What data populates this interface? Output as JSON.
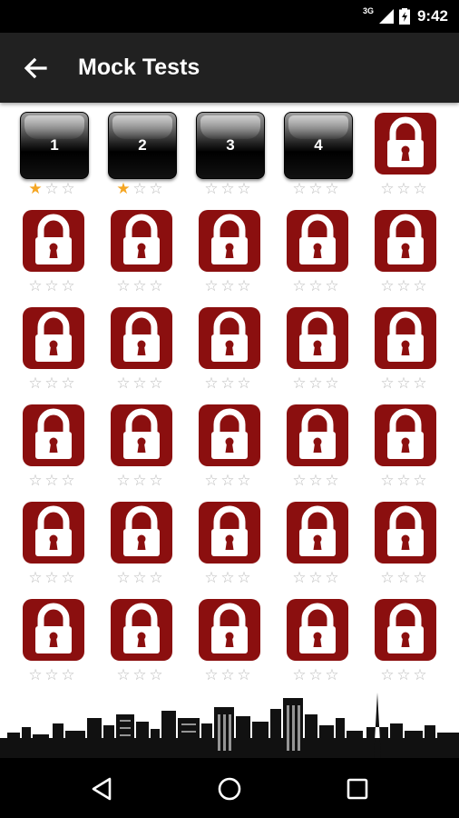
{
  "status_bar": {
    "network": "3G",
    "time": "9:42",
    "icons": [
      "signal-icon",
      "battery-icon"
    ]
  },
  "app_bar": {
    "title": "Mock Tests",
    "back_icon": "arrow-left-icon"
  },
  "levels": [
    {
      "label": "1",
      "locked": false,
      "stars": 1
    },
    {
      "label": "2",
      "locked": false,
      "stars": 1
    },
    {
      "label": "3",
      "locked": false,
      "stars": 0
    },
    {
      "label": "4",
      "locked": false,
      "stars": 0
    },
    {
      "label": "",
      "locked": true,
      "stars": 0
    },
    {
      "label": "",
      "locked": true,
      "stars": 0
    },
    {
      "label": "",
      "locked": true,
      "stars": 0
    },
    {
      "label": "",
      "locked": true,
      "stars": 0
    },
    {
      "label": "",
      "locked": true,
      "stars": 0
    },
    {
      "label": "",
      "locked": true,
      "stars": 0
    },
    {
      "label": "",
      "locked": true,
      "stars": 0
    },
    {
      "label": "",
      "locked": true,
      "stars": 0
    },
    {
      "label": "",
      "locked": true,
      "stars": 0
    },
    {
      "label": "",
      "locked": true,
      "stars": 0
    },
    {
      "label": "",
      "locked": true,
      "stars": 0
    },
    {
      "label": "",
      "locked": true,
      "stars": 0
    },
    {
      "label": "",
      "locked": true,
      "stars": 0
    },
    {
      "label": "",
      "locked": true,
      "stars": 0
    },
    {
      "label": "",
      "locked": true,
      "stars": 0
    },
    {
      "label": "",
      "locked": true,
      "stars": 0
    },
    {
      "label": "",
      "locked": true,
      "stars": 0
    },
    {
      "label": "",
      "locked": true,
      "stars": 0
    },
    {
      "label": "",
      "locked": true,
      "stars": 0
    },
    {
      "label": "",
      "locked": true,
      "stars": 0
    },
    {
      "label": "",
      "locked": true,
      "stars": 0
    },
    {
      "label": "",
      "locked": true,
      "stars": 0
    },
    {
      "label": "",
      "locked": true,
      "stars": 0
    },
    {
      "label": "",
      "locked": true,
      "stars": 0
    },
    {
      "label": "",
      "locked": true,
      "stars": 0
    },
    {
      "label": "",
      "locked": true,
      "stars": 0
    }
  ],
  "max_stars": 3,
  "colors": {
    "lock_red": "#8b0f0f",
    "star_filled": "#f5a623",
    "star_empty": "#bdbdbd",
    "app_bar": "#212121"
  },
  "nav_bar": {
    "buttons": [
      "back-triangle-icon",
      "home-circle-icon",
      "recents-square-icon"
    ]
  }
}
